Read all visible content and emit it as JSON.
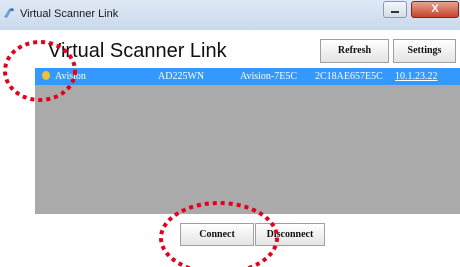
{
  "window": {
    "title": "Virtual Scanner Link",
    "close_label": "X"
  },
  "header": {
    "title": "Virtual Scanner Link"
  },
  "toolbar": {
    "refresh_label": "Refresh",
    "settings_label": "Settings"
  },
  "scanners": [
    {
      "name": "Avision",
      "model": "AD225WN",
      "host": "Avision-7E5C",
      "mac": "2C18AE657E5C",
      "ip": "10.1.23.22",
      "selected": true
    }
  ],
  "footer": {
    "connect_label": "Connect",
    "disconnect_label": "Disconnect"
  },
  "colors": {
    "selection": "#3399ff",
    "list_background": "#aaaaaa",
    "annotation": "#e4001a"
  },
  "icons": {
    "app": "scanner-link-icon",
    "status": "lightbulb-icon"
  }
}
